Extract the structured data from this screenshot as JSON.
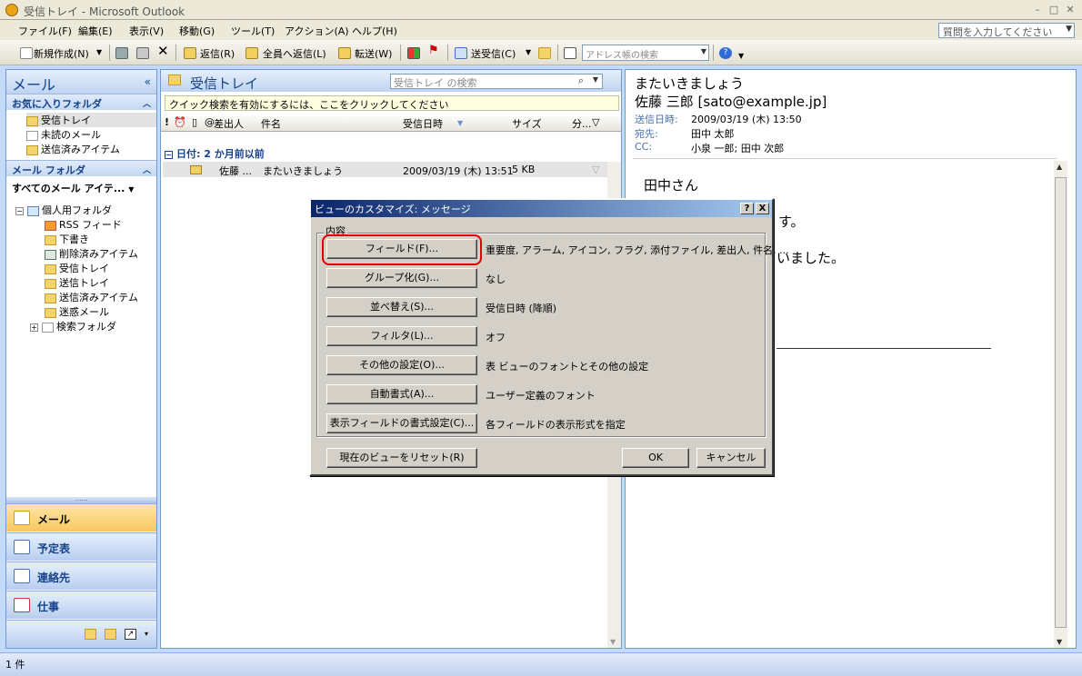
{
  "window": {
    "title": "受信トレイ - Microsoft Outlook",
    "min": "–",
    "max": "□",
    "close": "✕"
  },
  "menu": [
    "ファイル(F)",
    "編集(E)",
    "表示(V)",
    "移動(G)",
    "ツール(T)",
    "アクション(A)",
    "ヘルプ(H)"
  ],
  "help_placeholder": "質問を入力してください",
  "toolbar": {
    "new": "新規作成(N)",
    "reply": "返信(R)",
    "reply_all": "全員へ返信(L)",
    "forward": "転送(W)",
    "send_receive": "送受信(C)",
    "address_search": "アドレス帳の検索"
  },
  "nav": {
    "title": "メール",
    "favorites_title": "お気に入りフォルダ",
    "favorites": [
      "受信トレイ",
      "未読のメール",
      "送信済みアイテム"
    ],
    "mail_folders_title": "メール フォルダ",
    "all_mail": "すべてのメール アイテ...",
    "tree_root": "個人用フォルダ",
    "tree": [
      "RSS フィード",
      "下書き",
      "削除済みアイテム",
      "受信トレイ",
      "送信トレイ",
      "送信済みアイテム",
      "迷惑メール",
      "検索フォルダ"
    ],
    "buttons": [
      "メール",
      "予定表",
      "連絡先",
      "仕事"
    ]
  },
  "list": {
    "title": "受信トレイ",
    "search_placeholder": "受信トレイ の検索",
    "quick_search": "クイック検索を有効にするには、ここをクリックしてください",
    "columns": {
      "from": "差出人",
      "subject": "件名",
      "received": "受信日時",
      "size": "サイズ",
      "category": "分..."
    },
    "group": "日付: 2 か月前以前",
    "rows": [
      {
        "from": "佐藤 ...",
        "subject": "またいきましょう",
        "received": "2009/03/19 (木) 13:51",
        "size": "5 KB"
      }
    ]
  },
  "reading": {
    "subject": "またいきましょう",
    "from": "佐藤 三郎 [sato@example.jp]",
    "sent_label": "送信日時:",
    "sent_value": "2009/03/19 (木) 13:50",
    "to_label": "宛先:",
    "to_value": "田中 太郎",
    "cc_label": "CC:",
    "cc_value": "小泉 一郎; 田中 次郎",
    "body1": "田中さん",
    "body2": "す。",
    "body3": "いました。"
  },
  "status": {
    "count": "1 件"
  },
  "dialog": {
    "title": "ビューのカスタマイズ: メッセージ",
    "help": "?",
    "close": "X",
    "group_label": "内容",
    "rows": [
      {
        "button": "フィールド(F)...",
        "desc": "重要度, アラーム, アイコン, フラグ, 添付ファイル, 差出人, 件名, ..."
      },
      {
        "button": "グループ化(G)...",
        "desc": "なし"
      },
      {
        "button": "並べ替え(S)...",
        "desc": "受信日時 (降順)"
      },
      {
        "button": "フィルタ(L)...",
        "desc": "オフ"
      },
      {
        "button": "その他の設定(O)...",
        "desc": "表 ビューのフォントとその他の設定"
      },
      {
        "button": "自動書式(A)...",
        "desc": "ユーザー定義のフォント"
      },
      {
        "button": "表示フィールドの書式設定(C)...",
        "desc": "各フィールドの表示形式を指定"
      }
    ],
    "reset": "現在のビューをリセット(R)",
    "ok": "OK",
    "cancel": "キャンセル"
  },
  "colors": {
    "accent": "#15428b",
    "highlight": "#e00000",
    "nav_active": "#f9c75e"
  }
}
